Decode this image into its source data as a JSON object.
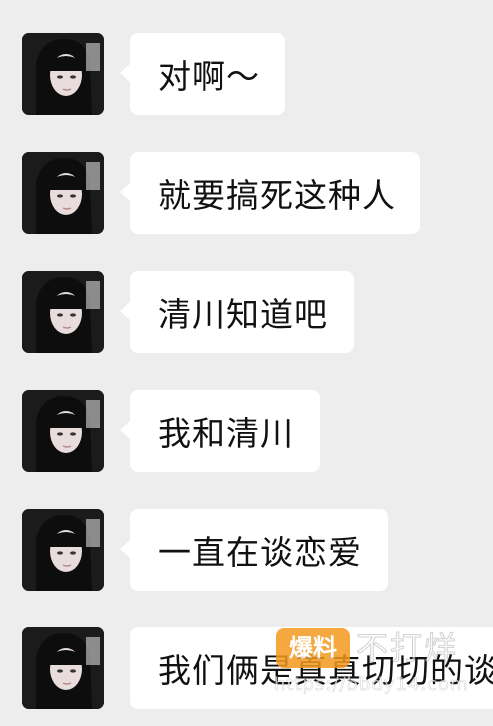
{
  "messages": [
    {
      "text": "对啊～"
    },
    {
      "text": "就要搞死这种人"
    },
    {
      "text": "清川知道吧"
    },
    {
      "text": "我和清川"
    },
    {
      "text": "一直在谈恋爱"
    },
    {
      "text": "我们俩是真真切切的谈"
    }
  ],
  "watermark": {
    "badge": "爆料",
    "title": "不打烊",
    "url": "https://bbdy14.com"
  },
  "colors": {
    "background": "#ededed",
    "bubble": "#ffffff",
    "text": "#111111",
    "watermark_badge": "#f39a1e"
  }
}
